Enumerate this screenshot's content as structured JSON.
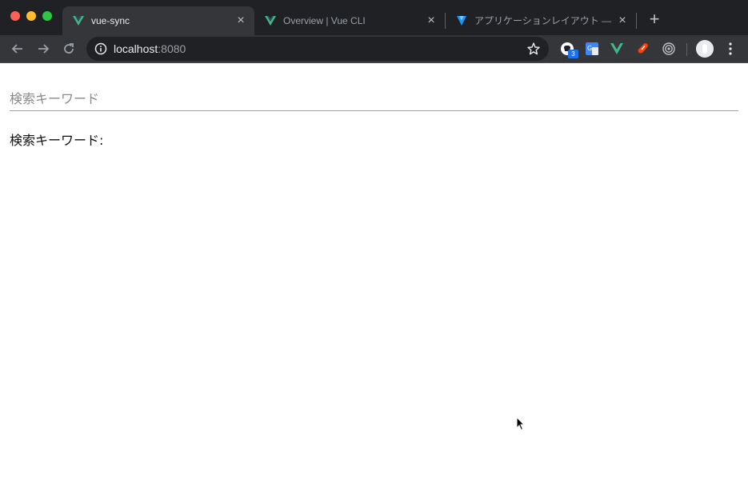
{
  "browser": {
    "tabs": [
      {
        "title": "vue-sync",
        "active": true,
        "icon": "vue-logo-icon"
      },
      {
        "title": "Overview | Vue CLI",
        "active": false,
        "icon": "vue-logo-icon"
      },
      {
        "title": "アプリケーションレイアウト — Vu",
        "active": false,
        "icon": "vuetify-logo-icon"
      }
    ],
    "new_tab_label": "+",
    "address": {
      "host": "localhost",
      "port": ":8080"
    },
    "extensions": [
      {
        "name": "github-extension-icon",
        "badge": "3"
      },
      {
        "name": "google-translate-icon"
      },
      {
        "name": "vue-devtools-icon"
      },
      {
        "name": "svelte-extension-icon"
      },
      {
        "name": "target-extension-icon"
      }
    ]
  },
  "page": {
    "search": {
      "placeholder": "検索キーワード",
      "value": ""
    },
    "output_label": "検索キーワード:"
  },
  "colors": {
    "vue_green": "#41b883",
    "vuetify_blue": "#1697f6",
    "chrome_dark": "#202124",
    "chrome_toolbar": "#35363a"
  }
}
